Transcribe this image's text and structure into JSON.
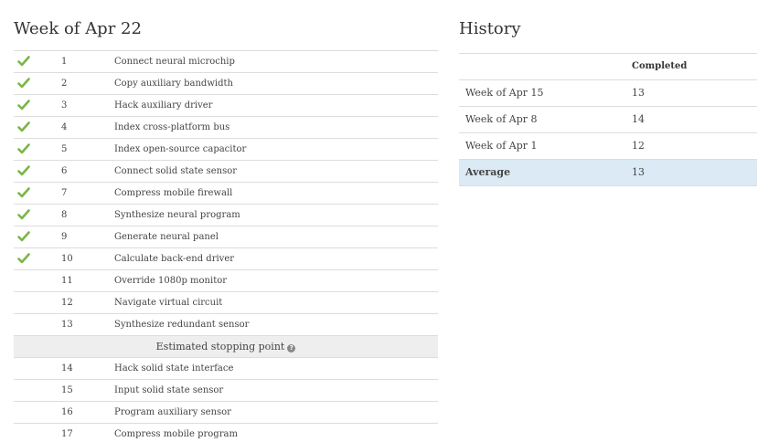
{
  "left": {
    "title": "Week of Apr 22",
    "tasks_before_stop": [
      {
        "done": true,
        "num": "1",
        "name": "Connect neural microchip"
      },
      {
        "done": true,
        "num": "2",
        "name": "Copy auxiliary bandwidth"
      },
      {
        "done": true,
        "num": "3",
        "name": "Hack auxiliary driver"
      },
      {
        "done": true,
        "num": "4",
        "name": "Index cross-platform bus"
      },
      {
        "done": true,
        "num": "5",
        "name": "Index open-source capacitor"
      },
      {
        "done": true,
        "num": "6",
        "name": "Connect solid state sensor"
      },
      {
        "done": true,
        "num": "7",
        "name": "Compress mobile firewall"
      },
      {
        "done": true,
        "num": "8",
        "name": "Synthesize neural program"
      },
      {
        "done": true,
        "num": "9",
        "name": "Generate neural panel"
      },
      {
        "done": true,
        "num": "10",
        "name": "Calculate back-end driver"
      },
      {
        "done": false,
        "num": "11",
        "name": "Override 1080p monitor"
      },
      {
        "done": false,
        "num": "12",
        "name": "Navigate virtual circuit"
      },
      {
        "done": false,
        "num": "13",
        "name": "Synthesize redundant sensor"
      }
    ],
    "stopping_point_label": "Estimated stopping point",
    "tasks_after_stop": [
      {
        "done": false,
        "num": "14",
        "name": "Hack solid state interface"
      },
      {
        "done": false,
        "num": "15",
        "name": "Input solid state sensor"
      },
      {
        "done": false,
        "num": "16",
        "name": "Program auxiliary sensor"
      },
      {
        "done": false,
        "num": "17",
        "name": "Compress mobile program"
      }
    ],
    "check_color": "#7ab648"
  },
  "history": {
    "title": "History",
    "header": {
      "col1": "",
      "col2": "Completed"
    },
    "rows": [
      {
        "label": "Week of Apr 15",
        "completed": "13"
      },
      {
        "label": "Week of Apr 8",
        "completed": "14"
      },
      {
        "label": "Week of Apr 1",
        "completed": "12"
      }
    ],
    "average": {
      "label": "Average",
      "completed": "13"
    },
    "average_bg": "#dbeaf4"
  }
}
